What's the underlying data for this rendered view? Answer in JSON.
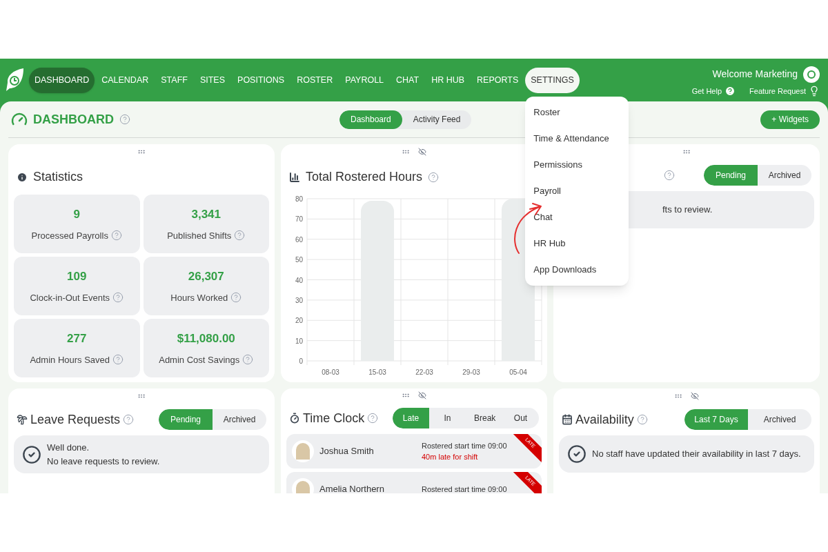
{
  "nav": {
    "items": [
      {
        "label": "DASHBOARD",
        "selected": true,
        "expanded": false
      },
      {
        "label": "CALENDAR",
        "selected": false,
        "expanded": false
      },
      {
        "label": "STAFF",
        "selected": false,
        "expanded": false
      },
      {
        "label": "SITES",
        "selected": false,
        "expanded": false
      },
      {
        "label": "POSITIONS",
        "selected": false,
        "expanded": false
      },
      {
        "label": "ROSTER",
        "selected": false,
        "expanded": false
      },
      {
        "label": "PAYROLL",
        "selected": false,
        "expanded": false
      },
      {
        "label": "CHAT",
        "selected": false,
        "expanded": false
      },
      {
        "label": "HR HUB",
        "selected": false,
        "expanded": false
      },
      {
        "label": "REPORTS",
        "selected": false,
        "expanded": false
      },
      {
        "label": "SETTINGS",
        "selected": false,
        "expanded": true
      }
    ]
  },
  "user": {
    "welcome": "Welcome Marketing",
    "links": [
      {
        "label": "Get Help",
        "kind": "help"
      },
      {
        "label": "Feature Request",
        "kind": "idea"
      }
    ]
  },
  "settings_menu": {
    "items": [
      "Roster",
      "Time & Attendance",
      "Permissions",
      "Payroll",
      "Chat",
      "HR Hub",
      "App Downloads"
    ]
  },
  "page": {
    "title": "DASHBOARD",
    "view_tabs": [
      {
        "label": "Dashboard",
        "selected": true
      },
      {
        "label": "Activity Feed",
        "selected": false
      }
    ],
    "add_button": "+ Widgets"
  },
  "statistics": {
    "title": "Statistics",
    "tiles": [
      {
        "value": "9",
        "label": "Processed Payrolls"
      },
      {
        "value": "3,341",
        "label": "Published Shifts"
      },
      {
        "value": "109",
        "label": "Clock-in-Out Events"
      },
      {
        "value": "26,307",
        "label": "Hours Worked"
      },
      {
        "value": "277",
        "label": "Admin Hours Saved"
      },
      {
        "value": "$11,080.00",
        "label": "Admin Cost Savings"
      }
    ]
  },
  "rostered_hours": {
    "title": "Total Rostered Hours",
    "chart_data": {
      "type": "bar",
      "categories": [
        "08-03",
        "15-03",
        "22-03",
        "29-03",
        "05-04"
      ],
      "values": [
        0,
        79,
        0,
        0,
        80
      ],
      "grid": true,
      "ylim": [
        0,
        80
      ],
      "yticks": [
        0,
        10,
        20,
        30,
        40,
        50,
        60,
        70,
        80
      ]
    }
  },
  "shifts_card": {
    "tabs": [
      {
        "label": "Pending",
        "selected": true
      },
      {
        "label": "Archived",
        "selected": false
      }
    ],
    "message": "fts to review."
  },
  "leave_requests": {
    "title": "Leave Requests",
    "tabs": [
      {
        "label": "Pending",
        "selected": true
      },
      {
        "label": "Archived",
        "selected": false
      }
    ],
    "message_lines": [
      "Well done.",
      "No leave requests to review."
    ]
  },
  "time_clock": {
    "title": "Time Clock",
    "tabs": [
      {
        "label": "Late",
        "selected": true
      },
      {
        "label": "In",
        "selected": false
      },
      {
        "label": "Break",
        "selected": false
      },
      {
        "label": "Out",
        "selected": false
      }
    ],
    "rows": [
      {
        "name": "Joshua Smith",
        "roster_note": "Rostered start time 09:00",
        "late_note": "40m late for shift",
        "badge": "LATE"
      },
      {
        "name": "Amelia Northern",
        "roster_note": "Rostered start time 09:00",
        "badge": "LATE"
      }
    ]
  },
  "availability": {
    "title": "Availability",
    "tabs": [
      {
        "label": "Last 7 Days",
        "selected": true
      },
      {
        "label": "Archived",
        "selected": false
      }
    ],
    "message": "No staff have updated their availability in last 7 days."
  }
}
